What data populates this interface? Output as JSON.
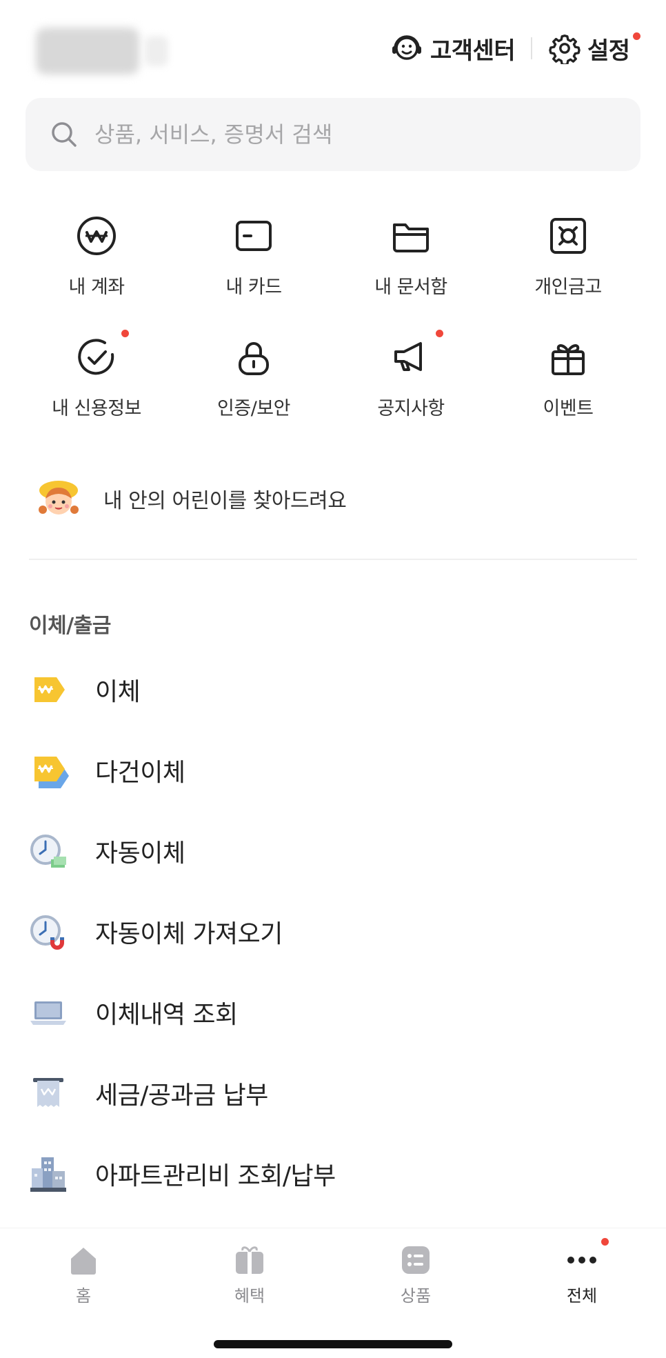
{
  "header": {
    "customer_center_label": "고객센터",
    "settings_label": "설정"
  },
  "search": {
    "placeholder": "상품, 서비스, 증명서 검색"
  },
  "quick_menu": [
    {
      "label": "내 계좌",
      "icon": "won-circle-icon",
      "badge": false
    },
    {
      "label": "내 카드",
      "icon": "card-icon",
      "badge": false
    },
    {
      "label": "내 문서함",
      "icon": "folder-icon",
      "badge": false
    },
    {
      "label": "개인금고",
      "icon": "safe-icon",
      "badge": false
    },
    {
      "label": "내 신용정보",
      "icon": "check-circle-icon",
      "badge": true
    },
    {
      "label": "인증/보안",
      "icon": "lock-icon",
      "badge": false
    },
    {
      "label": "공지사항",
      "icon": "megaphone-icon",
      "badge": true
    },
    {
      "label": "이벤트",
      "icon": "gift-icon",
      "badge": false
    }
  ],
  "banner": {
    "text": "내 안의 어린이를 찾아드려요",
    "icon": "child-face-icon"
  },
  "section": {
    "title": "이체/출금",
    "items": [
      {
        "label": "이체",
        "icon": "won-tag-icon"
      },
      {
        "label": "다건이체",
        "icon": "multi-won-tag-icon"
      },
      {
        "label": "자동이체",
        "icon": "clock-money-icon"
      },
      {
        "label": "자동이체 가져오기",
        "icon": "clock-magnet-icon"
      },
      {
        "label": "이체내역 조회",
        "icon": "laptop-icon"
      },
      {
        "label": "세금/공과금 납부",
        "icon": "receipt-icon"
      },
      {
        "label": "아파트관리비 조회/납부",
        "icon": "apartment-icon"
      }
    ]
  },
  "tabbar": {
    "tabs": [
      {
        "label": "홈",
        "icon": "home-icon",
        "active": false
      },
      {
        "label": "혜택",
        "icon": "gift-box-icon",
        "active": false
      },
      {
        "label": "상품",
        "icon": "list-icon",
        "active": false
      },
      {
        "label": "전체",
        "icon": "more-dots-icon",
        "active": true
      }
    ]
  },
  "colors": {
    "badge_red": "#f0473b",
    "icon_dark": "#222222",
    "tab_inactive": "#8a8a8e",
    "accent_yellow": "#f7c531"
  }
}
